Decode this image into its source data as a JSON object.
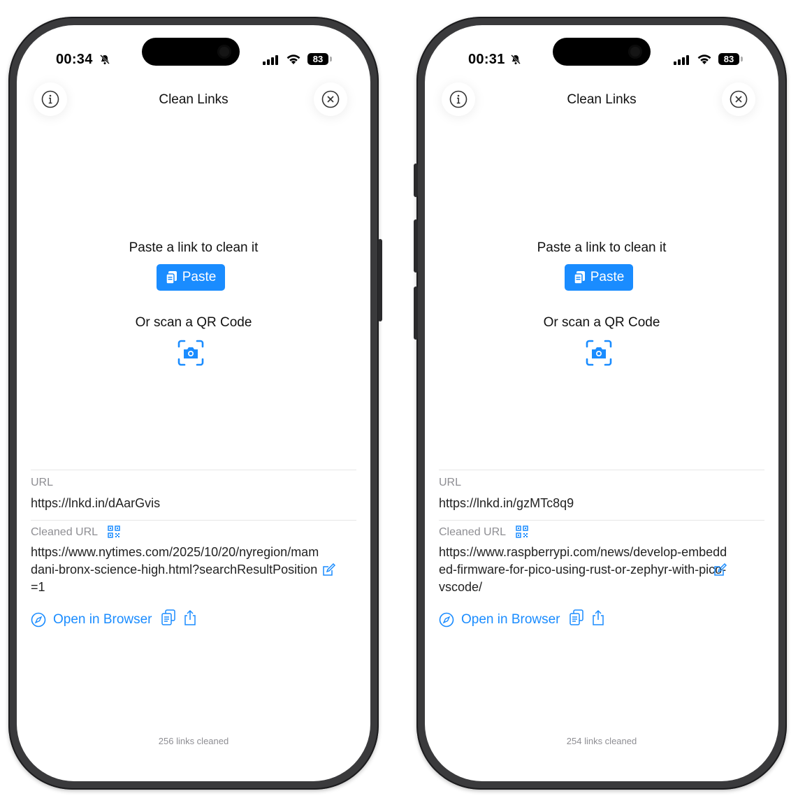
{
  "colors": {
    "accent": "#1a8cff",
    "frame": "#3a3a3c",
    "secondary_text": "#8e8e93"
  },
  "phones": [
    {
      "status": {
        "time": "00:34",
        "battery": "83",
        "icons": [
          "bell-slash-icon",
          "signal-icon",
          "wifi-icon",
          "battery-icon"
        ]
      },
      "nav": {
        "title": "Clean Links",
        "info_icon": "info-icon",
        "close_icon": "close-icon"
      },
      "main": {
        "prompt": "Paste a link to clean it",
        "paste_label": "Paste",
        "scan_text": "Or scan a QR Code",
        "scan_icon": "camera-scan-icon"
      },
      "form": {
        "url_label": "URL",
        "url_value": "https://lnkd.in/dAarGvis",
        "cleaned_label": "Cleaned URL",
        "cleaned_value": "https://www.nytimes.com/2025/10/20/nyregion/mamdani-bronx-science-high.html?searchResultPosition=1"
      },
      "actions": {
        "open_label": "Open in Browser"
      },
      "footer": {
        "count": "256 links cleaned"
      }
    },
    {
      "status": {
        "time": "00:31",
        "battery": "83",
        "icons": [
          "bell-slash-icon",
          "signal-icon",
          "wifi-icon",
          "battery-icon"
        ]
      },
      "nav": {
        "title": "Clean Links",
        "info_icon": "info-icon",
        "close_icon": "close-icon"
      },
      "main": {
        "prompt": "Paste a link to clean it",
        "paste_label": "Paste",
        "scan_text": "Or scan a QR Code",
        "scan_icon": "camera-scan-icon"
      },
      "form": {
        "url_label": "URL",
        "url_value": "https://lnkd.in/gzMTc8q9",
        "cleaned_label": "Cleaned URL",
        "cleaned_value": "https://www.raspberrypi.com/news/develop-embedded-firmware-for-pico-using-rust-or-zephyr-with-pico-vscode/"
      },
      "actions": {
        "open_label": "Open in Browser"
      },
      "footer": {
        "count": "254 links cleaned"
      }
    }
  ]
}
